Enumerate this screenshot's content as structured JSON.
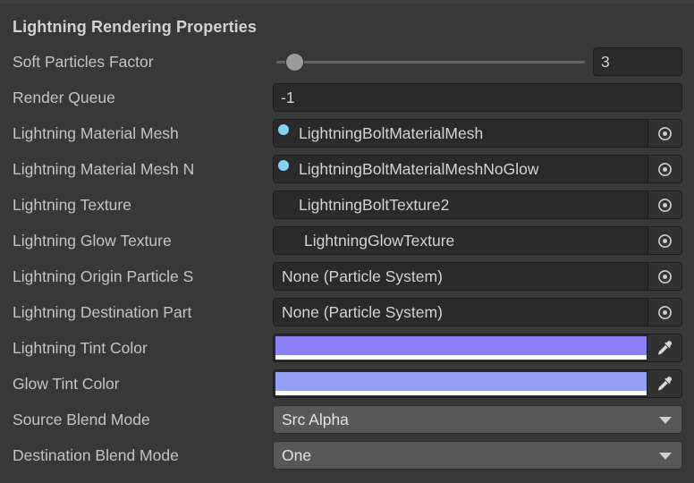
{
  "panel": {
    "title": "Lightning Rendering Properties",
    "background_color": "#383838"
  },
  "rows": [
    {
      "label": "Soft Particles Factor",
      "type": "slider",
      "value": "3",
      "slider_fill_fraction": 0.05
    },
    {
      "label": "Render Queue",
      "type": "number",
      "value": "-1"
    },
    {
      "label": "Lightning Material Mesh",
      "type": "object",
      "value": "LightningBoltMaterialMesh",
      "icon": "material-sphere-icon",
      "picker_icon": "object-picker-icon"
    },
    {
      "label": "Lightning Material Mesh N",
      "type": "object",
      "value": "LightningBoltMaterialMeshNoGlow",
      "icon": "material-sphere-icon",
      "picker_icon": "object-picker-icon"
    },
    {
      "label": "Lightning Texture",
      "type": "object",
      "value": "LightningBoltTexture2",
      "icon": "texture-gradient-icon",
      "picker_icon": "object-picker-icon"
    },
    {
      "label": "Lightning Glow Texture",
      "type": "object",
      "value": "LightningGlowTexture",
      "icon": "texture-glow-icon",
      "picker_icon": "object-picker-icon"
    },
    {
      "label": "Lightning Origin Particle S",
      "type": "object",
      "value": "None (Particle System)",
      "icon": "none-icon",
      "picker_icon": "object-picker-icon"
    },
    {
      "label": "Lightning Destination Part",
      "type": "object",
      "value": "None (Particle System)",
      "icon": "none-icon",
      "picker_icon": "object-picker-icon"
    },
    {
      "label": "Lightning Tint Color",
      "type": "color",
      "color": "#8a80f5",
      "alpha_color": "#ffffff",
      "picker_icon": "eyedropper-icon"
    },
    {
      "label": "Glow Tint Color",
      "type": "color",
      "color": "#93a0f6",
      "alpha_color": "#ffffff",
      "picker_icon": "eyedropper-icon"
    },
    {
      "label": "Source Blend Mode",
      "type": "dropdown",
      "value": "Src Alpha",
      "arrow_icon": "chevron-down-icon"
    },
    {
      "label": "Destination Blend Mode",
      "type": "dropdown",
      "value": "One",
      "arrow_icon": "chevron-down-icon"
    }
  ]
}
